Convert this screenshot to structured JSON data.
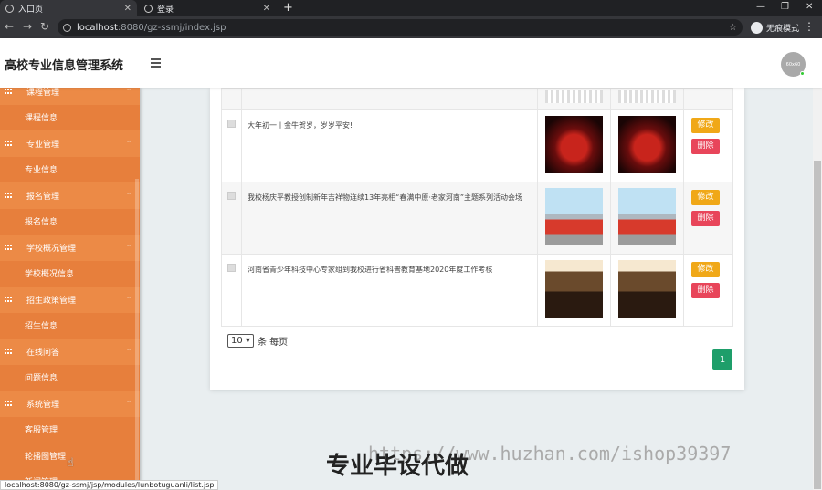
{
  "browser": {
    "tabs": [
      {
        "label": "入口页",
        "active": true
      },
      {
        "label": "登录",
        "active": false
      }
    ],
    "url_host": "localhost",
    "url_path": ":8080/gz-ssmj/index.jsp",
    "incognito_label": "无痕模式",
    "status_url": "localhost:8080/gz-ssmj/jsp/modules/lunbotuguanli/list.jsp"
  },
  "header": {
    "title": "高校专业信息管理系统",
    "avatar_text": "60x60"
  },
  "sidebar": {
    "groups": [
      {
        "label": "课程管理",
        "items": [
          "课程信息"
        ]
      },
      {
        "label": "专业管理",
        "items": [
          "专业信息"
        ]
      },
      {
        "label": "报名管理",
        "items": [
          "报名信息"
        ]
      },
      {
        "label": "学校概况管理",
        "items": [
          "学校概况信息"
        ]
      },
      {
        "label": "招生政策管理",
        "items": [
          "招生信息"
        ]
      },
      {
        "label": "在线问答",
        "items": [
          "问题信息"
        ]
      },
      {
        "label": "系统管理",
        "items": [
          "客服管理",
          "轮播图管理",
          "新闻管理"
        ]
      }
    ]
  },
  "table": {
    "rows": [
      {
        "title": "",
        "image": "banner",
        "partial": true
      },
      {
        "title": "大年初一丨金牛贺岁，岁岁平安!",
        "image": "festival"
      },
      {
        "title": "我校杨庆平教授创制新年吉祥物连续13年亮相“春满中原·老家河南”主题系列活动会场",
        "image": "boat"
      },
      {
        "title": "河南省青少年科技中心专家组到我校进行省科普教育基地2020年度工作考核",
        "image": "meeting"
      }
    ],
    "edit_label": "修改",
    "delete_label": "删除"
  },
  "pager": {
    "page_size": "10",
    "suffix": "条 每页",
    "current_page": "1"
  },
  "watermark": {
    "url_text": "https://www.huzhan.com/ishop39397",
    "cn_text": "专业毕设代做"
  }
}
